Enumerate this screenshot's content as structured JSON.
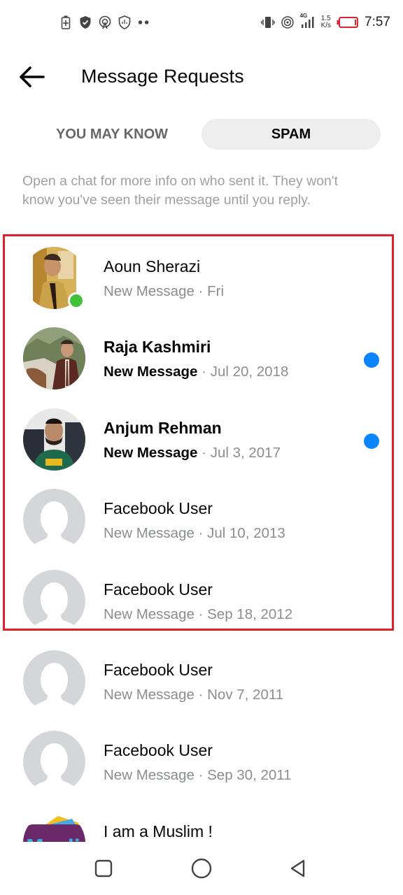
{
  "status_bar": {
    "left_icons": [
      "battery-saver-icon",
      "shield-check-icon",
      "hotspot-icon",
      "shield-chart-icon",
      "more-dots-icon"
    ],
    "right_icons": [
      "vibrate-icon",
      "hotspot-signal-icon",
      "signal-4g-icon"
    ],
    "network_type": "4G",
    "speed_value": "1.5",
    "speed_unit": "K/s",
    "battery_color": "#e0202c",
    "time": "7:57"
  },
  "header": {
    "back_icon": "arrow-left-icon",
    "title": "Message Requests"
  },
  "tabs": [
    {
      "label": "YOU MAY KNOW",
      "active": false
    },
    {
      "label": "SPAM",
      "active": true
    }
  ],
  "info_text": "Open a chat for more info on who sent it. They won't know you've seen their message until you reply.",
  "colors": {
    "unread": "#0a84ff",
    "online": "#44c13b",
    "highlight_border": "#e0202c",
    "placeholder_avatar": "#d4d6da"
  },
  "requests": [
    {
      "name": "Aoun Sherazi",
      "status": "New Message",
      "separator": "·",
      "date": "Fri",
      "unread": false,
      "online": true,
      "avatar": "photo-man-yellow-coat"
    },
    {
      "name": "Raja Kashmiri",
      "status": "New Message",
      "separator": "·",
      "date": "Jul 20, 2018",
      "unread": true,
      "online": false,
      "avatar": "photo-man-suit-mountains"
    },
    {
      "name": "Anjum Rehman",
      "status": "New Message",
      "separator": "·",
      "date": "Jul 3, 2017",
      "unread": true,
      "online": false,
      "avatar": "photo-man-green-hoodie"
    },
    {
      "name": "Facebook User",
      "status": "New Message",
      "separator": "·",
      "date": "Jul 10, 2013",
      "unread": false,
      "online": false,
      "avatar": "default-silhouette"
    },
    {
      "name": "Facebook User",
      "status": "New Message",
      "separator": "·",
      "date": "Sep 18, 2012",
      "unread": false,
      "online": false,
      "avatar": "default-silhouette"
    },
    {
      "name": "Facebook User",
      "status": "New Message",
      "separator": "·",
      "date": "Nov 7, 2011",
      "unread": false,
      "online": false,
      "avatar": "default-silhouette"
    },
    {
      "name": "Facebook User",
      "status": "New Message",
      "separator": "·",
      "date": "Sep 30, 2011",
      "unread": false,
      "online": false,
      "avatar": "default-silhouette"
    },
    {
      "name": "I am a Muslim !",
      "avatar": "muslim-logo",
      "avatar_text": "Muslim"
    }
  ],
  "nav": {
    "recents_icon": "square-recents-icon",
    "home_icon": "circle-home-icon",
    "back_icon": "triangle-back-icon"
  }
}
